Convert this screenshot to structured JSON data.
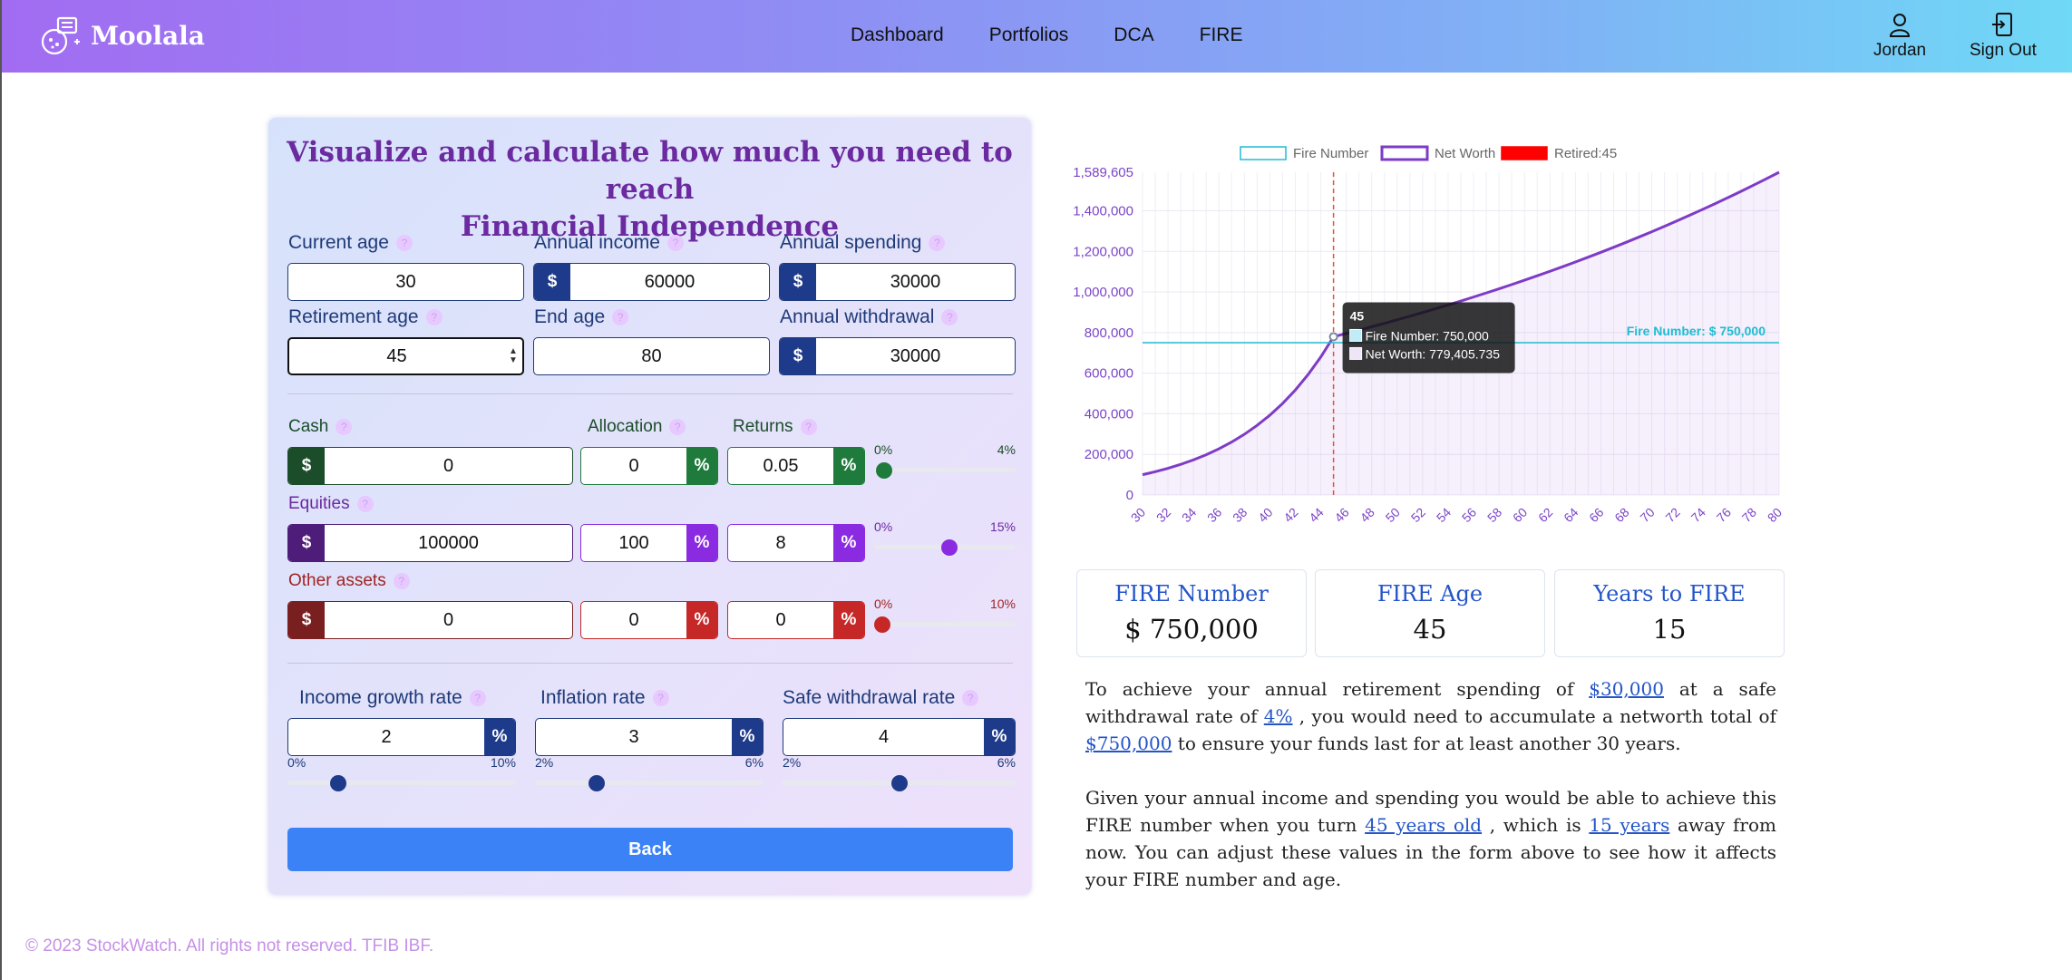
{
  "brand": {
    "name": "Moolala"
  },
  "nav": {
    "links": [
      "Dashboard",
      "Portfolios",
      "DCA",
      "FIRE"
    ],
    "user": "Jordan",
    "signout": "Sign Out"
  },
  "form": {
    "title_line1": "Visualize and calculate how much you need to reach",
    "title_line2": "Financial Independence",
    "current_age": {
      "label": "Current age",
      "value": "30"
    },
    "annual_income": {
      "label": "Annual income",
      "value": "60000",
      "prefix": "$"
    },
    "annual_spending": {
      "label": "Annual spending",
      "value": "30000",
      "prefix": "$"
    },
    "retirement_age": {
      "label": "Retirement age",
      "value": "45"
    },
    "end_age": {
      "label": "End age",
      "value": "80"
    },
    "annual_withdrawal": {
      "label": "Annual withdrawal",
      "value": "30000",
      "prefix": "$"
    },
    "headers": {
      "cash": "Cash",
      "allocation": "Allocation",
      "returns": "Returns",
      "equities": "Equities",
      "other": "Other assets"
    },
    "cash": {
      "amount": "0",
      "allocation": "0",
      "returns": "0.05",
      "min": "0%",
      "max": "4%",
      "level": 0.0125,
      "color": "#1e7b3c",
      "dark": "#1c4d2a"
    },
    "equities": {
      "amount": "100000",
      "allocation": "100",
      "returns": "8",
      "min": "0%",
      "max": "15%",
      "level": 0.533,
      "color": "#8a2be2",
      "dark": "#4e1d7a"
    },
    "other": {
      "amount": "0",
      "allocation": "0",
      "returns": "0",
      "min": "0%",
      "max": "10%",
      "level": 0.0,
      "color": "#c62828",
      "dark": "#7a1f1f"
    },
    "income_growth": {
      "label": "Income growth rate",
      "value": "2",
      "min": "0%",
      "max": "10%",
      "level": 0.2
    },
    "inflation": {
      "label": "Inflation rate",
      "value": "3",
      "min": "2%",
      "max": "6%",
      "level": 0.25
    },
    "safe_withdrawal": {
      "label": "Safe withdrawal rate",
      "value": "4",
      "min": "2%",
      "max": "6%",
      "level": 0.5
    },
    "percent": "%",
    "back": "Back"
  },
  "chart_data": {
    "type": "line",
    "legend": [
      "Fire Number",
      "Net Worth",
      "Retired:45"
    ],
    "x": [
      30,
      31,
      32,
      33,
      34,
      35,
      36,
      37,
      38,
      39,
      40,
      41,
      42,
      43,
      44,
      45,
      46,
      47,
      48,
      49,
      50,
      51,
      52,
      53,
      54,
      55,
      56,
      57,
      58,
      59,
      60,
      61,
      62,
      63,
      64,
      65,
      66,
      67,
      68,
      69,
      70,
      71,
      72,
      73,
      74,
      75,
      76,
      77,
      78,
      79,
      80
    ],
    "x_ticks": [
      "30",
      "32",
      "34",
      "36",
      "38",
      "40",
      "42",
      "44",
      "46",
      "48",
      "50",
      "52",
      "54",
      "56",
      "58",
      "60",
      "62",
      "64",
      "66",
      "68",
      "70",
      "72",
      "74",
      "76",
      "78",
      "80"
    ],
    "y_ticks": [
      "0",
      "200,000",
      "400,000",
      "600,000",
      "800,000",
      "1,000,000",
      "1,200,000",
      "1,400,000",
      "1,589,605"
    ],
    "ylim": [
      0,
      1589605
    ],
    "series": [
      {
        "name": "Fire Number",
        "color": "#1fbcd2",
        "values_constant": 750000
      },
      {
        "name": "Net Worth",
        "color": "#7e3bc7",
        "start": 100000,
        "retire": 779405.735,
        "end": 1589605
      }
    ],
    "annotation": "Fire Number: $ 750,000",
    "retired_x": 45,
    "tooltip": {
      "title": "45",
      "line1": "Fire Number: 750,000",
      "line2": "Net Worth: 779,405.735"
    }
  },
  "stats": [
    {
      "title": "FIRE Number",
      "value": "$ 750,000"
    },
    {
      "title": "FIRE Age",
      "value": "45"
    },
    {
      "title": "Years to FIRE",
      "value": "15"
    }
  ],
  "para1": {
    "t1": "To achieve your annual retirement spending of ",
    "l1": "$30,000",
    "t2": " at a safe withdrawal rate of ",
    "l2": "4%",
    "t3": " , you would need to accumulate a networth total of ",
    "l3": "$750,000",
    "t4": " to ensure your funds last for at least another 30 years."
  },
  "para2": {
    "t1": "Given your annual income and spending you would be able to achieve this FIRE number when you turn ",
    "l1": "45 years old",
    "t2": " , which is ",
    "l2": "15 years",
    "t3": " away from now. You can adjust these values in the form above to see how it affects your FIRE number and age."
  },
  "footer": "© 2023 StockWatch. All rights not reserved. TFIB IBF."
}
